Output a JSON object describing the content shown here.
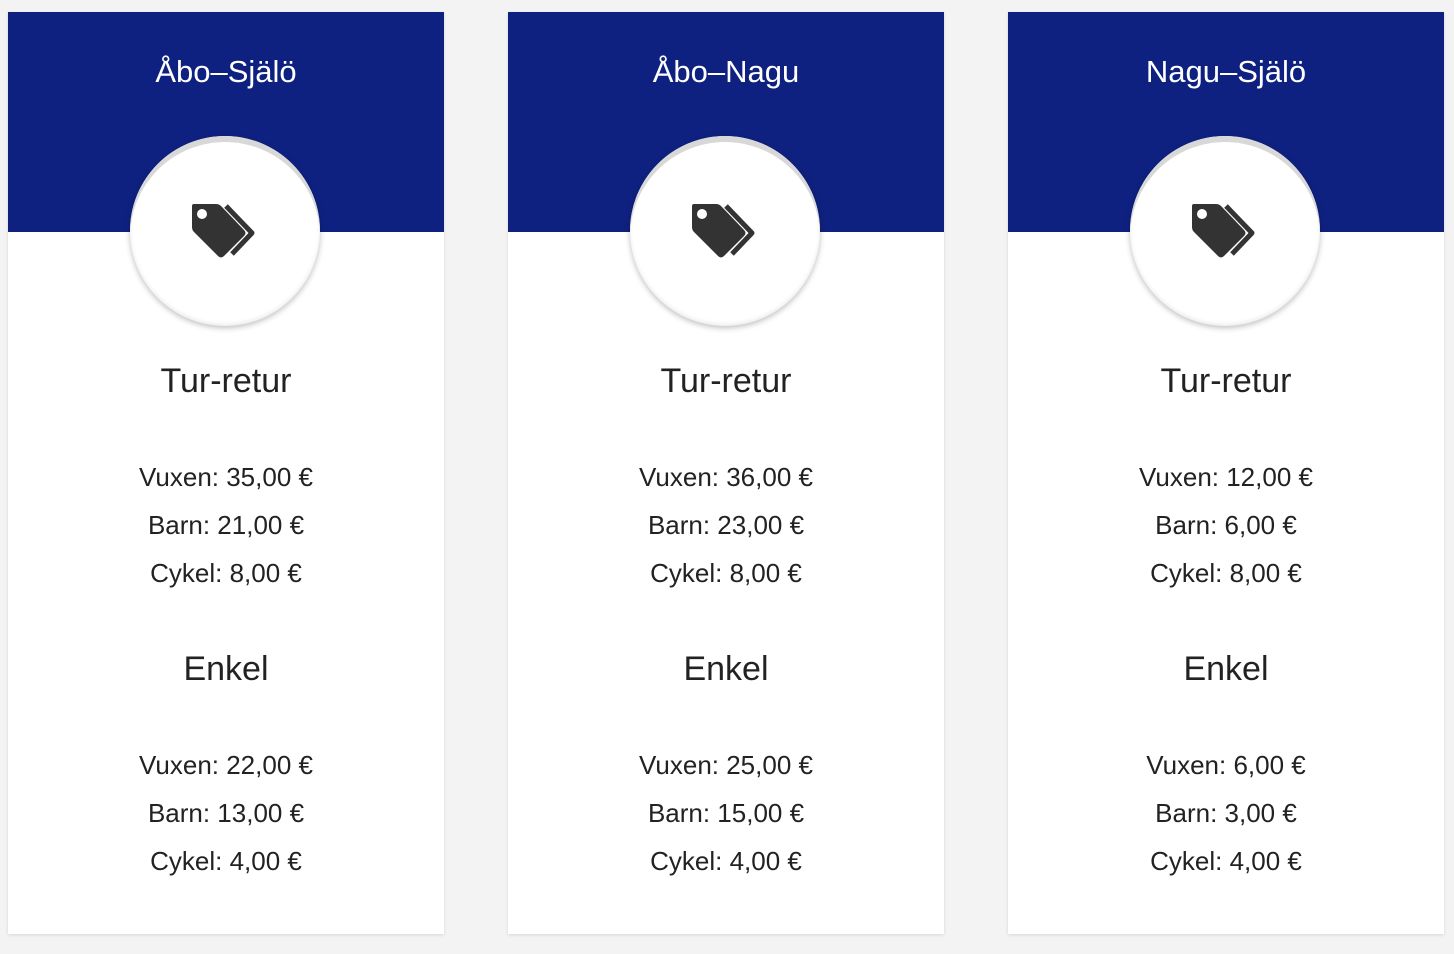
{
  "colors": {
    "header_bg": "#0f2180",
    "page_bg": "#f3f3f3",
    "card_bg": "#ffffff",
    "text": "#222222",
    "icon": "#333333"
  },
  "cards": [
    {
      "route": "Åbo–Själö",
      "icon": "tags-icon",
      "roundtrip": {
        "title": "Tur-retur",
        "lines": [
          "Vuxen: 35,00 €",
          "Barn: 21,00 €",
          "Cykel: 8,00 €"
        ]
      },
      "single": {
        "title": "Enkel",
        "lines": [
          "Vuxen: 22,00 €",
          "Barn: 13,00 €",
          "Cykel: 4,00 €"
        ]
      }
    },
    {
      "route": "Åbo–Nagu",
      "icon": "tags-icon",
      "roundtrip": {
        "title": "Tur-retur",
        "lines": [
          "Vuxen: 36,00 €",
          "Barn: 23,00 €",
          "Cykel: 8,00 €"
        ]
      },
      "single": {
        "title": "Enkel",
        "lines": [
          "Vuxen: 25,00 €",
          "Barn: 15,00 €",
          "Cykel: 4,00 €"
        ]
      }
    },
    {
      "route": "Nagu–Själö",
      "icon": "tags-icon",
      "roundtrip": {
        "title": "Tur-retur",
        "lines": [
          "Vuxen: 12,00 €",
          "Barn: 6,00 €",
          "Cykel: 8,00 €"
        ]
      },
      "single": {
        "title": "Enkel",
        "lines": [
          "Vuxen: 6,00 €",
          "Barn: 3,00 €",
          "Cykel: 4,00 €"
        ]
      }
    }
  ]
}
